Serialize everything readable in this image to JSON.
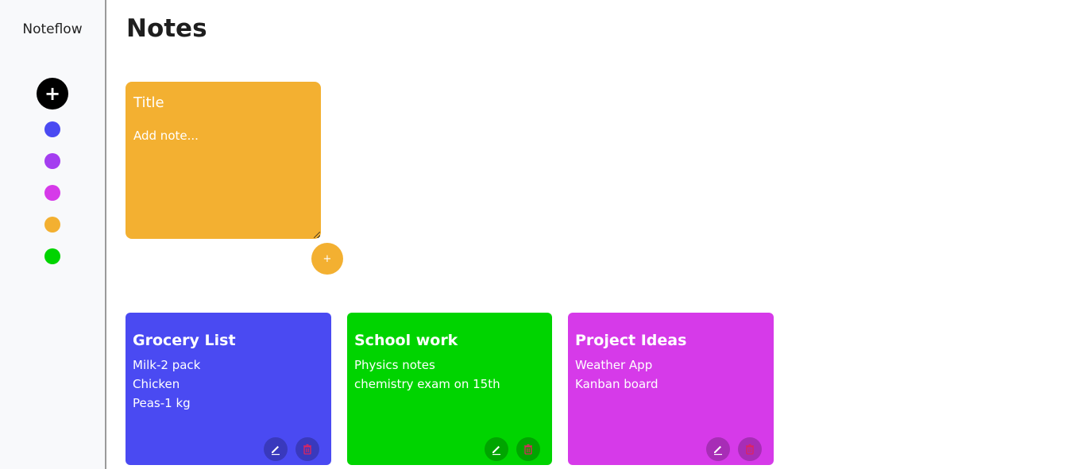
{
  "app": {
    "brand": "Noteflow"
  },
  "sidebar": {
    "add_symbol": "+",
    "colors": [
      {
        "name": "blue",
        "hex": "#4a4af2"
      },
      {
        "name": "purple",
        "hex": "#a43ef0"
      },
      {
        "name": "magenta",
        "hex": "#d63ae9"
      },
      {
        "name": "orange",
        "hex": "#f3b031"
      },
      {
        "name": "green",
        "hex": "#00d400"
      }
    ]
  },
  "main": {
    "title": "Notes"
  },
  "composer": {
    "title_placeholder": "Title",
    "note_placeholder": "Add note...",
    "add_symbol": "+",
    "color": "#f3b031"
  },
  "notes": [
    {
      "title": "Grocery List",
      "lines": [
        "Milk-2 pack",
        "Chicken",
        "Peas-1 kg"
      ],
      "color": "#4a4af2"
    },
    {
      "title": "School work",
      "lines": [
        "Physics notes",
        "chemistry exam on 15th"
      ],
      "color": "#00d400"
    },
    {
      "title": "Project Ideas",
      "lines": [
        "Weather App",
        "Kanban board"
      ],
      "color": "#d63ae9"
    }
  ],
  "icons": {
    "edit": "pencil-icon",
    "delete": "trash-icon",
    "delete_color": "#e0245e"
  }
}
